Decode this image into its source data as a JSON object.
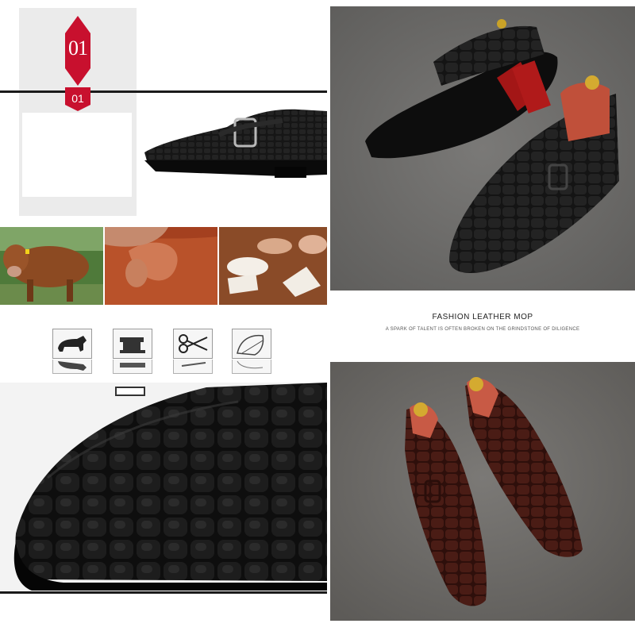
{
  "badge": {
    "number_large": "01",
    "number_small": "01",
    "color": "#c8102e"
  },
  "caption": {
    "title": "FASHION LEATHER MOP",
    "subtitle": "A SPARK OF TALENT IS OFTEN BROKEN ON THE GRINDSTONE OF DILIGENCE"
  },
  "process_icons": [
    {
      "icon": "bull-icon"
    },
    {
      "icon": "sewing-machine-icon"
    },
    {
      "icon": "scissors-icon"
    },
    {
      "icon": "pattern-template-icon"
    }
  ],
  "colors": {
    "leather_black": "#121212",
    "leather_brown": "#3a1410",
    "sole_red": "#a31616",
    "backdrop_gray": "#6f6e6c"
  }
}
